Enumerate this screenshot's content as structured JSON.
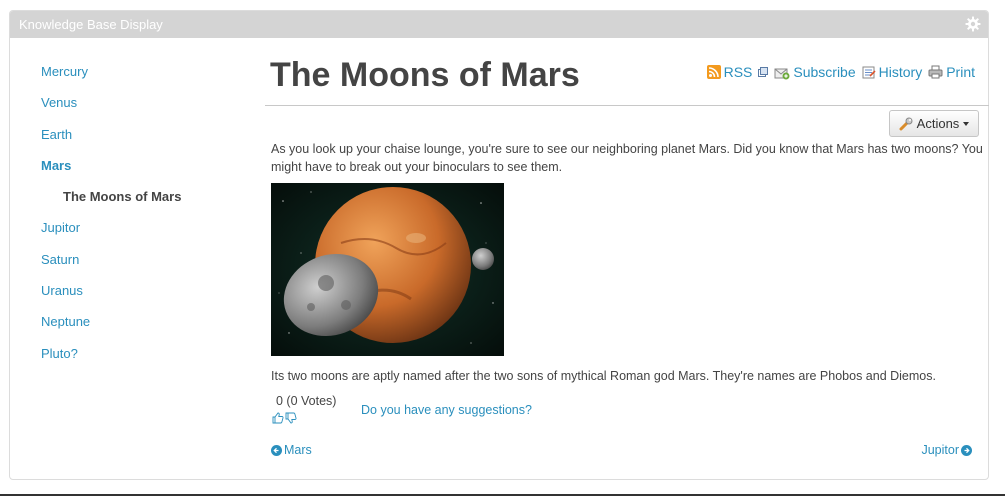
{
  "portlet": {
    "title": "Knowledge Base Display"
  },
  "nav": {
    "items": [
      {
        "label": "Mercury"
      },
      {
        "label": "Venus"
      },
      {
        "label": "Earth"
      },
      {
        "label": "Mars"
      },
      {
        "label": "The Moons of Mars"
      },
      {
        "label": "Jupitor"
      },
      {
        "label": "Saturn"
      },
      {
        "label": "Uranus"
      },
      {
        "label": "Neptune"
      },
      {
        "label": "Pluto?"
      }
    ]
  },
  "article": {
    "title": "The Moons of Mars",
    "intro": "As you look up your chaise lounge, you're sure to see our neighboring planet Mars. Did you know that Mars has two moons? You might have to break out your binoculars to see them.",
    "body": "Its two moons are aptly named after the two sons of mythical Roman god Mars. They're names are Phobos and Diemos."
  },
  "toolbar": {
    "rss": "RSS",
    "subscribe": "Subscribe",
    "history": "History",
    "print": "Print"
  },
  "actions": {
    "label": "Actions"
  },
  "ratings": {
    "votes": "0 (0 Votes)"
  },
  "suggestions": {
    "link": "Do you have any suggestions?"
  },
  "pager": {
    "prev": "Mars",
    "next": "Jupitor"
  },
  "colors": {
    "link": "#2a8fbd",
    "titlebar": "#d4d4d4",
    "text": "#444444"
  }
}
